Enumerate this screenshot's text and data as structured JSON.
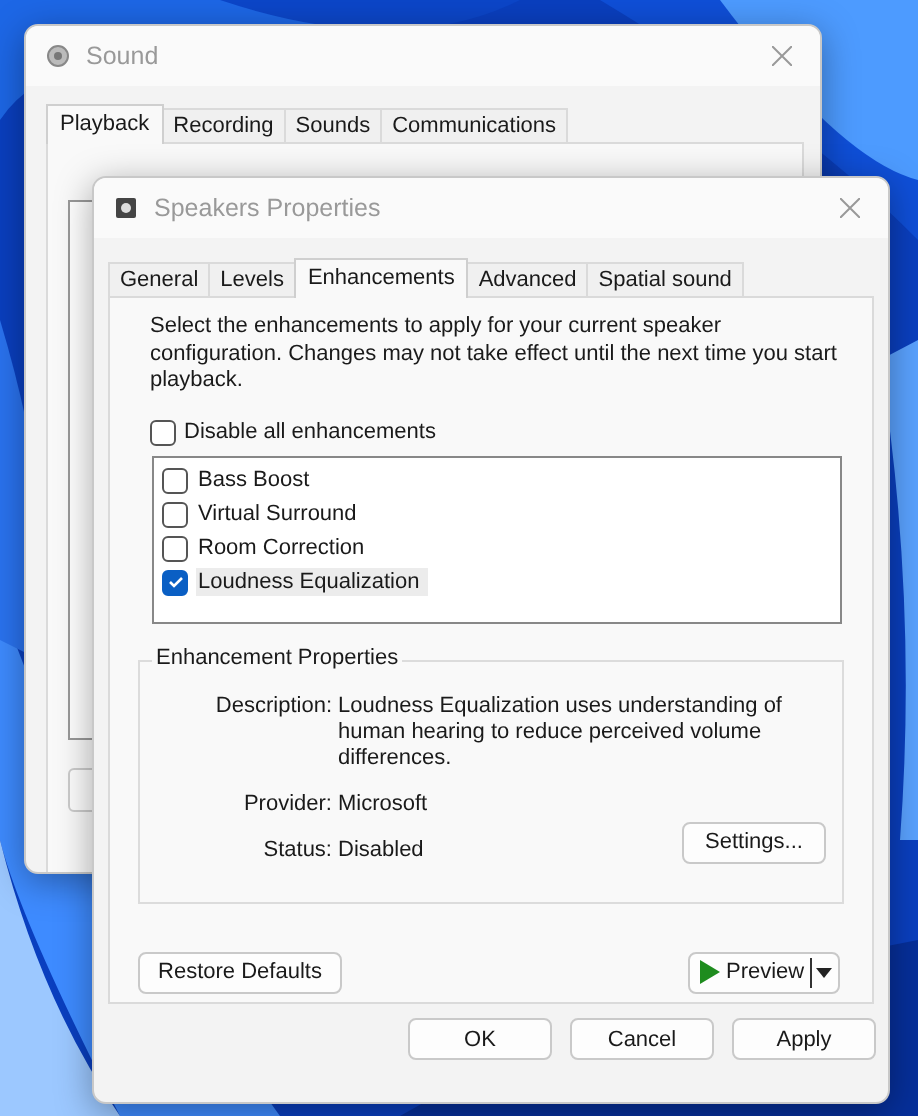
{
  "sound_window": {
    "title": "Sound",
    "tabs": [
      {
        "label": "Playback",
        "selected": true
      },
      {
        "label": "Recording",
        "selected": false
      },
      {
        "label": "Sounds",
        "selected": false
      },
      {
        "label": "Communications",
        "selected": false
      }
    ]
  },
  "properties_window": {
    "title": "Speakers Properties",
    "tabs": [
      {
        "label": "General",
        "selected": false
      },
      {
        "label": "Levels",
        "selected": false
      },
      {
        "label": "Enhancements",
        "selected": true
      },
      {
        "label": "Advanced",
        "selected": false
      },
      {
        "label": "Spatial sound",
        "selected": false
      }
    ],
    "intro": "Select the enhancements to apply for your current speaker configuration. Changes may not take effect until the next time you start playback.",
    "disable_all": {
      "label": "Disable all enhancements",
      "checked": false
    },
    "enhancements": [
      {
        "label": "Bass Boost",
        "checked": false,
        "selected": false
      },
      {
        "label": "Virtual Surround",
        "checked": false,
        "selected": false
      },
      {
        "label": "Room Correction",
        "checked": false,
        "selected": false
      },
      {
        "label": "Loudness Equalization",
        "checked": true,
        "selected": true
      }
    ],
    "properties": {
      "title": "Enhancement Properties",
      "fields": [
        {
          "label": "Description:",
          "value": "Loudness Equalization uses understanding of human hearing to reduce perceived volume differences."
        },
        {
          "label": "Provider:",
          "value": "Microsoft"
        },
        {
          "label": "Status:",
          "value": "Disabled"
        }
      ],
      "settings_button": "Settings..."
    },
    "restore_button": "Restore Defaults",
    "preview_button": "Preview",
    "buttons": [
      "OK",
      "Cancel",
      "Apply"
    ]
  }
}
